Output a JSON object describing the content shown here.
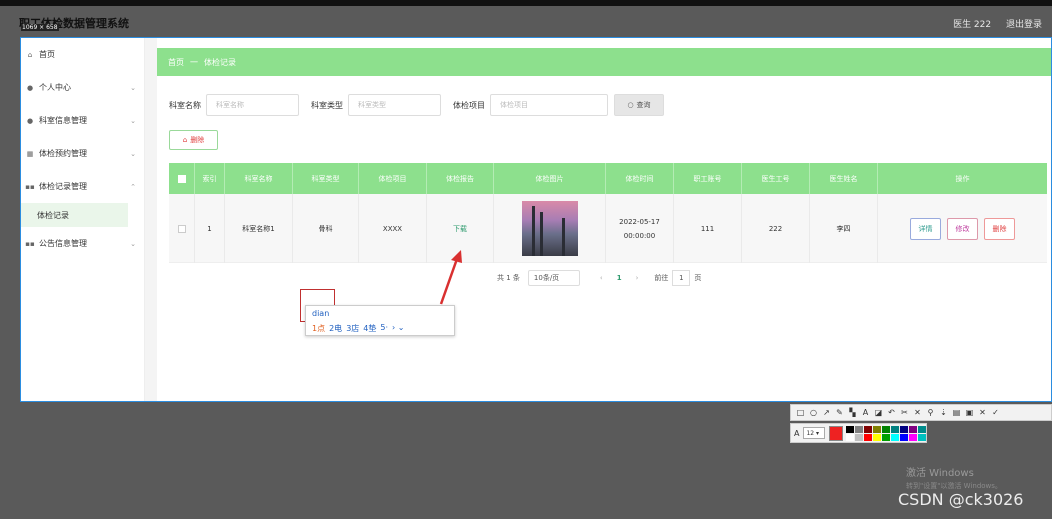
{
  "app": {
    "title": "职工体检数据管理系统",
    "user_label": "医生 222",
    "logout_label": "退出登录",
    "capture_size_label": "1069 × 658"
  },
  "sidebar": {
    "items": [
      {
        "icon": "home-icon",
        "label": "首页"
      },
      {
        "icon": "user-icon",
        "label": "个人中心"
      },
      {
        "icon": "user-icon",
        "label": "科室信息管理"
      },
      {
        "icon": "calendar-icon",
        "label": "体检预约管理"
      },
      {
        "icon": "grid-icon",
        "label": "体检记录管理"
      },
      {
        "icon": "grid-icon",
        "label": "公告信息管理"
      }
    ],
    "active_sub": "体检记录"
  },
  "breadcrumb": {
    "home": "首页",
    "separator": "一",
    "current": "体检记录"
  },
  "search": {
    "fields": [
      {
        "label": "科室名称",
        "placeholder": "科室名称"
      },
      {
        "label": "科室类型",
        "placeholder": "科室类型"
      },
      {
        "label": "体检项目",
        "placeholder": "体检项目"
      }
    ],
    "query_label": "查询"
  },
  "delete_label": "删除",
  "table": {
    "headers": [
      "索引",
      "科室名称",
      "科室类型",
      "体检项目",
      "体检报告",
      "体检图片",
      "体检时间",
      "职工账号",
      "医生工号",
      "医生姓名",
      "操作"
    ],
    "rows": [
      {
        "index": "1",
        "dept_name": "科室名称1",
        "dept_type": "骨科",
        "item": "XXXX",
        "report": "下载",
        "time": "2022-05-17 00:00:00",
        "staff_account": "111",
        "doctor_id": "222",
        "doctor_name": "李四"
      }
    ],
    "actions": {
      "detail": "详情",
      "edit": "修改",
      "delete": "删除"
    }
  },
  "pagination": {
    "total": "共 1 条",
    "page_size": "10条/页",
    "current_page": "1",
    "goto_label": "前往",
    "goto_value": "1",
    "page_suffix": "页"
  },
  "ime": {
    "input": "dian",
    "candidates": [
      "1点",
      "2电",
      "3店",
      "4垫",
      "5·"
    ]
  },
  "colors": {
    "accent_green": "#8de08d",
    "delete_red": "#e04040",
    "annotation_red": "#d93030"
  },
  "watermark": {
    "title": "激活 Windows",
    "subtitle": "转到\"设置\"以激活 Windows。",
    "csdn": "CSDN @ck3026"
  }
}
